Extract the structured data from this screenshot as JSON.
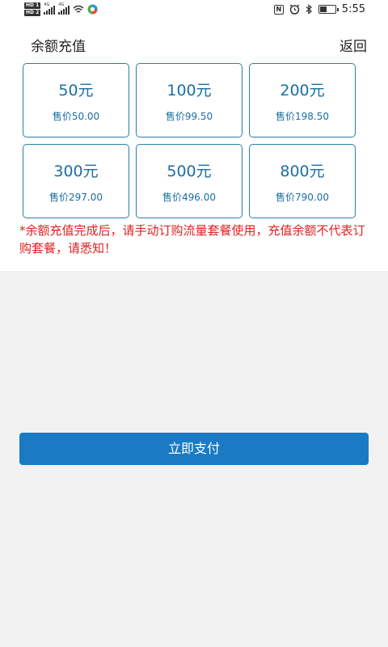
{
  "status_bar": {
    "time": "5:55",
    "left_badges": [
      "HD 1",
      "HD 2"
    ],
    "network_labels": [
      "4G",
      "4G"
    ],
    "icons": [
      "signal-icon",
      "wifi-icon",
      "app-icon",
      "nfc-icon",
      "alarm-icon",
      "bluetooth-icon",
      "battery-icon"
    ]
  },
  "header": {
    "title": "余额充值",
    "back": "返回"
  },
  "options": [
    {
      "amount": "50元",
      "price": "售价50.00"
    },
    {
      "amount": "100元",
      "price": "售价99.50"
    },
    {
      "amount": "200元",
      "price": "售价198.50"
    },
    {
      "amount": "300元",
      "price": "售价297.00"
    },
    {
      "amount": "500元",
      "price": "售价496.00"
    },
    {
      "amount": "800元",
      "price": "售价790.00"
    }
  ],
  "notice": "*余额充值完成后，请手动订购流量套餐使用，充值余额不代表订购套餐，请悉知！",
  "pay_button": "立即支付",
  "colors": {
    "accent": "#1a7bc4",
    "card_border": "#2a7ea6",
    "notice": "#e02020",
    "background": "#f2f2f2"
  }
}
